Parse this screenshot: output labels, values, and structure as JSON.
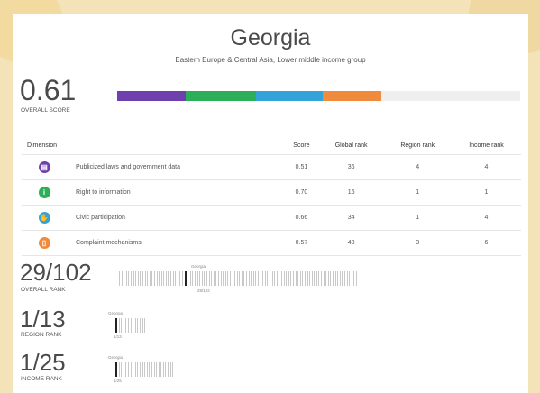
{
  "country": "Georgia",
  "subtitle": "Eastern Europe & Central Asia, Lower middle income group",
  "overall_score": {
    "value": "0.61",
    "label": "OVERALL SCORE"
  },
  "score_bar": {
    "segments": [
      {
        "name": "Publicized laws and government data",
        "color": "#6f3fae",
        "fraction": 0.17
      },
      {
        "name": "Right to information",
        "color": "#2dae58",
        "fraction": 0.175
      },
      {
        "name": "Civic participation",
        "color": "#33a3d9",
        "fraction": 0.165
      },
      {
        "name": "Complaint mechanisms",
        "color": "#f08a3c",
        "fraction": 0.145
      }
    ]
  },
  "table": {
    "headers": {
      "dimension": "Dimension",
      "score": "Score",
      "global": "Global rank",
      "region": "Region rank",
      "income": "Income rank"
    },
    "rows": [
      {
        "icon": "building-icon",
        "icon_color": "#6f3fae",
        "glyph": "▤",
        "label": "Publicized laws and government data",
        "score": "0.51",
        "global": "36",
        "region": "4",
        "income": "4"
      },
      {
        "icon": "info-icon",
        "icon_color": "#2dae58",
        "glyph": "i",
        "label": "Right to information",
        "score": "0.70",
        "global": "16",
        "region": "1",
        "income": "1"
      },
      {
        "icon": "hand-icon",
        "icon_color": "#33a3d9",
        "glyph": "✋",
        "label": "Civic participation",
        "score": "0.66",
        "global": "34",
        "region": "1",
        "income": "4"
      },
      {
        "icon": "complaint-book-icon",
        "icon_color": "#f08a3c",
        "glyph": "▯",
        "label": "Complaint mechanisms",
        "score": "0.57",
        "global": "48",
        "region": "3",
        "income": "6"
      }
    ]
  },
  "overall_rank": {
    "value": "29/102",
    "label": "OVERALL RANK",
    "rank": 29,
    "total": 102,
    "marker_label": "Georgia",
    "marker_caption": "29/102"
  },
  "region_rank": {
    "value": "1/13",
    "label": "REGION RANK",
    "rank": 1,
    "total": 13,
    "marker_label": "Georgia",
    "marker_caption": "1/13"
  },
  "income_rank": {
    "value": "1/25",
    "label": "INCOME RANK",
    "rank": 1,
    "total": 25,
    "marker_label": "Georgia",
    "marker_caption": "1/25"
  }
}
